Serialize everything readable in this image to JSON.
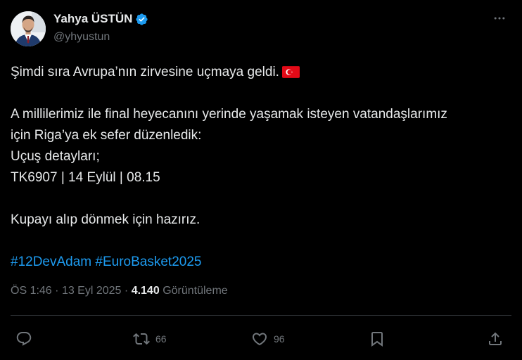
{
  "author": {
    "display_name": "Yahya ÜSTÜN",
    "handle": "@yhyustun",
    "verified": true
  },
  "tweet": {
    "lines": [
      "Şimdi sıra Avrupa’nın zirvesine uçmaya geldi.",
      "",
      "A millilerimiz ile final heyecanını yerinde yaşamak isteyen vatandaşlarımız",
      "için Riga’ya ek sefer düzenledik:",
      "Uçuş detayları;",
      "TK6907 | 14 Eylül | 08.15",
      "",
      "Kupayı alıp dönmek için hazırız."
    ],
    "hashtags": [
      "#12DevAdam",
      "#EuroBasket2025"
    ]
  },
  "meta": {
    "time": "ÖS 1:46",
    "separator": "·",
    "date": "13 Eyl 2025",
    "views_count": "4.140",
    "views_label": "Görüntüleme"
  },
  "actions": {
    "reply_count": "",
    "retweet_count": "66",
    "like_count": "96"
  },
  "colors": {
    "background": "#000000",
    "text": "#e7e9ea",
    "secondary": "#71767b",
    "accent": "#1d9bf0",
    "verified": "#1d9bf0",
    "divider": "#2f3336"
  },
  "icons": {
    "verified": "verified-badge-icon",
    "more": "more-horizontal-icon",
    "flag": "turkey-flag-icon",
    "reply": "reply-icon",
    "retweet": "retweet-icon",
    "like": "heart-icon",
    "bookmark": "bookmark-icon",
    "share": "share-icon"
  }
}
